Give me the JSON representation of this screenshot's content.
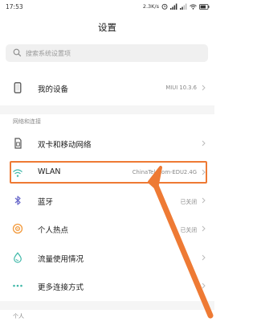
{
  "status_bar": {
    "time": "17:53",
    "network_speed": "2.3K/s"
  },
  "header": {
    "title": "设置"
  },
  "search": {
    "placeholder": "搜索系统设置项"
  },
  "device_row": {
    "label": "我的设备",
    "value": "MIUI 10.3.6",
    "icon": "phone-icon"
  },
  "sections": {
    "network_header": "网络和连接",
    "personal_header": "个人"
  },
  "network_items": [
    {
      "label": "双卡和移动网络",
      "value": "",
      "icon": "sim-card-icon"
    },
    {
      "label": "WLAN",
      "value": "ChinaTelecom-EDU2.4G",
      "icon": "wifi-icon"
    },
    {
      "label": "蓝牙",
      "value": "已关闭",
      "icon": "bluetooth-icon"
    },
    {
      "label": "个人热点",
      "value": "已关闭",
      "icon": "hotspot-icon"
    },
    {
      "label": "流量使用情况",
      "value": "",
      "icon": "data-usage-icon"
    },
    {
      "label": "更多连接方式",
      "value": "",
      "icon": "more-dots-icon"
    }
  ],
  "colors": {
    "accent_orange": "#ee7a34",
    "hotspot_orange": "#f29a3c",
    "teal_icon": "#3fb8a8"
  }
}
